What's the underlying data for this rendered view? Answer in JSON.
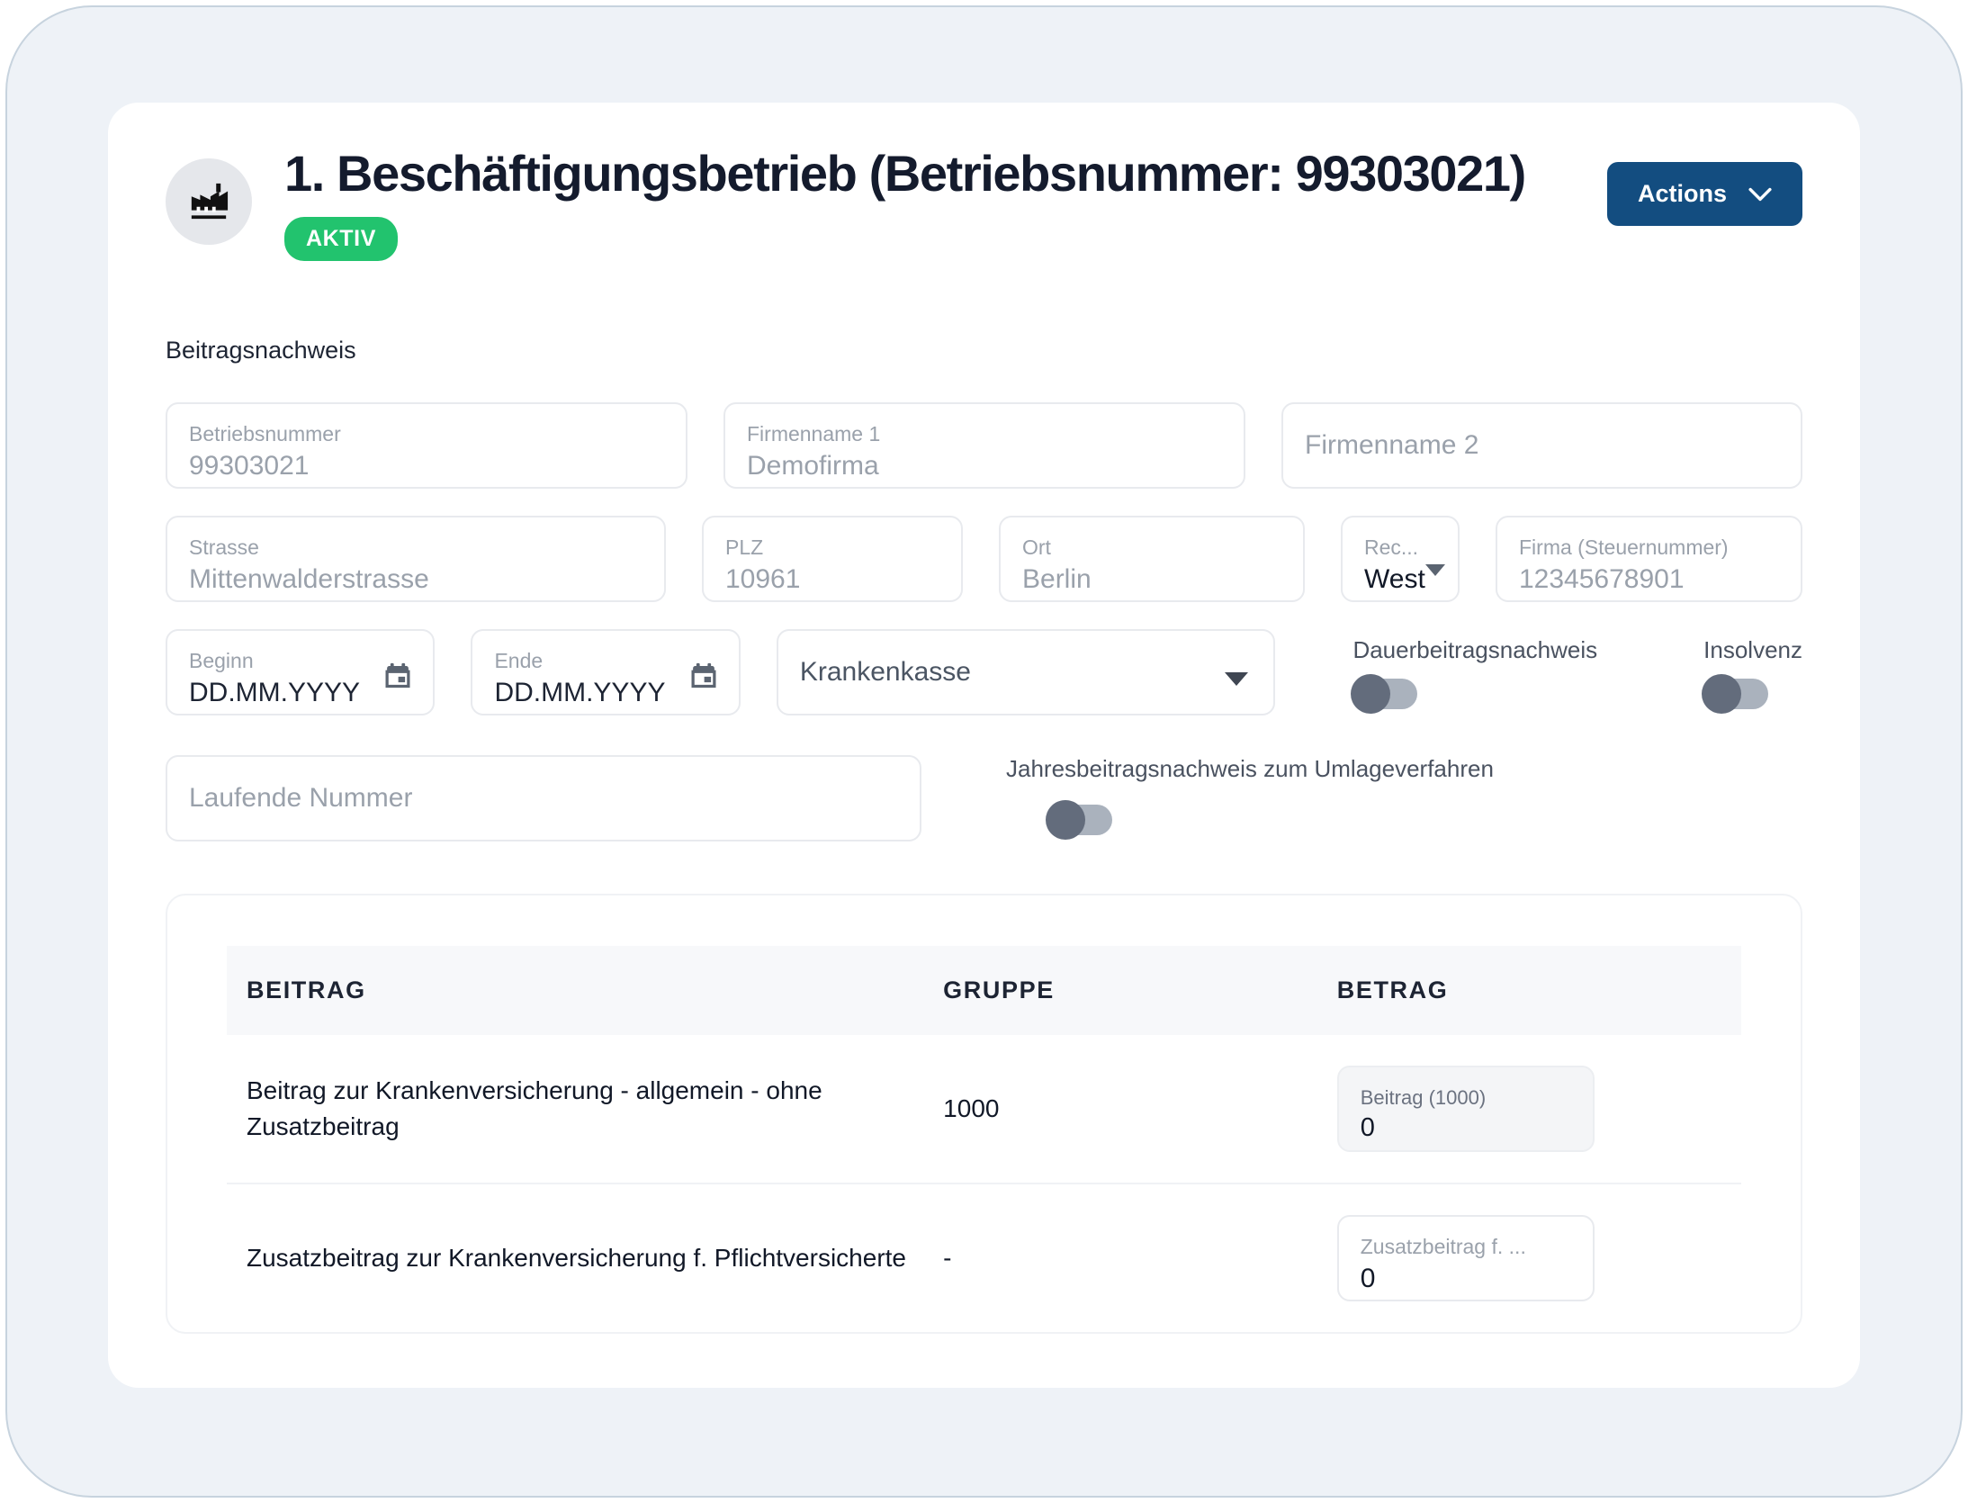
{
  "header": {
    "icon": "factory-icon",
    "title": "1. Beschäftigungsbetrieb (Betriebsnummer: 99303021)",
    "status_badge": "AKTIV",
    "actions_label": "Actions",
    "actions_caret": "chevron-down-icon",
    "accent_color": "#134d80",
    "badge_color": "#22c36e"
  },
  "section": {
    "title": "Beitragsnachweis"
  },
  "form": {
    "betriebsnummer": {
      "label": "Betriebsnummer",
      "value": "99303021"
    },
    "firmenname1": {
      "label": "Firmenname 1",
      "value": "Demofirma"
    },
    "firmenname2": {
      "label": "Firmenname 2",
      "placeholder": "Firmenname 2"
    },
    "strasse": {
      "label": "Strasse",
      "value": "Mittenwalderstrasse"
    },
    "plz": {
      "label": "PLZ",
      "value": "10961"
    },
    "ort": {
      "label": "Ort",
      "value": "Berlin"
    },
    "rechtskreis": {
      "label": "Rec...",
      "value": "West"
    },
    "steuernummer": {
      "label": "Firma (Steuernummer)",
      "value": "12345678901"
    },
    "beginn": {
      "label": "Beginn",
      "value": "DD.MM.YYYY"
    },
    "ende": {
      "label": "Ende",
      "value": "DD.MM.YYYY"
    },
    "krankenkasse": {
      "label": "Krankenkasse",
      "value": "Krankenkasse"
    },
    "laufende_nummer": {
      "placeholder": "Laufende Nummer"
    },
    "toggles": {
      "dauerbeitragsnachweis": {
        "label": "Dauerbeitragsnachweis",
        "state": "off"
      },
      "insolvenz": {
        "label": "Insolvenz",
        "state": "off"
      },
      "jahresbeitragsnachweis": {
        "label": "Jahresbeitragsnachweis zum Umlageverfahren",
        "state": "off"
      }
    }
  },
  "table": {
    "columns": [
      "BEITRAG",
      "GRUPPE",
      "BETRAG"
    ],
    "rows": [
      {
        "beitrag": "Beitrag zur Krankenversicherung - allgemein - ohne Zusatzbeitrag",
        "gruppe": "1000",
        "amount_label": "Beitrag (1000)",
        "amount_value": "0"
      },
      {
        "beitrag": "Zusatzbeitrag zur Krankenversicherung f. Pflichtversicherte",
        "gruppe": "-",
        "amount_label": "Zusatzbeitrag f. ...",
        "amount_value": "0"
      }
    ]
  }
}
